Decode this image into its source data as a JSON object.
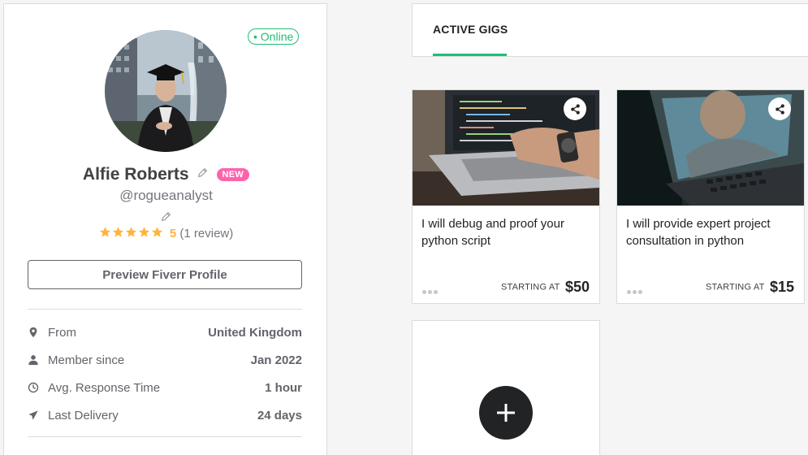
{
  "profile": {
    "status": "• Online",
    "name": "Alfie Roberts",
    "badge": "NEW",
    "username": "@rogueanalyst",
    "rating_score": "5",
    "rating_count": "(1 review)",
    "stars": 5,
    "preview_button": "Preview Fiverr Profile",
    "stats": [
      {
        "icon": "location-pin-icon",
        "label": "From",
        "value": "United Kingdom"
      },
      {
        "icon": "user-icon",
        "label": "Member since",
        "value": "Jan 2022"
      },
      {
        "icon": "clock-icon",
        "label": "Avg. Response Time",
        "value": "1 hour"
      },
      {
        "icon": "paper-plane-icon",
        "label": "Last Delivery",
        "value": "24 days"
      }
    ]
  },
  "tabs": {
    "active": "ACTIVE GIGS"
  },
  "gigs": [
    {
      "title": "I will debug and proof your python script",
      "starting_label": "STARTING AT",
      "price": "$50"
    },
    {
      "title": "I will provide expert project consultation in python",
      "starting_label": "STARTING AT",
      "price": "$15"
    }
  ],
  "colors": {
    "accent": "#1dbf73",
    "new_badge": "#ff62ad",
    "star": "#ffb33e",
    "dark": "#222325"
  }
}
